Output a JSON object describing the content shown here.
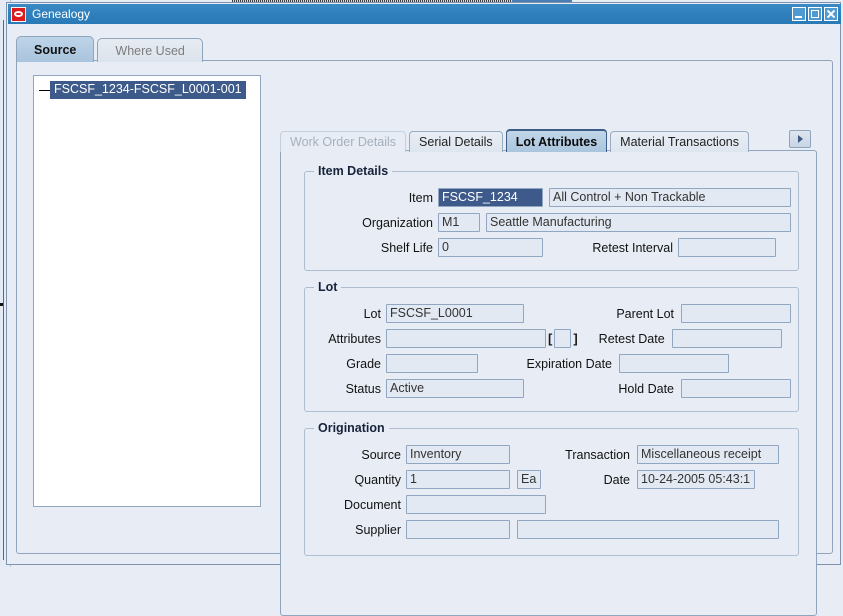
{
  "window": {
    "title": "Genealogy",
    "logo_icon": "oracle-logo-icon",
    "minimize_label": "minimize-icon",
    "maximize_label": "maximize-icon",
    "close_label": "close-icon"
  },
  "outer_tabs": [
    {
      "label": "Source",
      "active": true
    },
    {
      "label": "Where Used",
      "active": false
    }
  ],
  "tree": {
    "nodes": [
      {
        "label": "FSCSF_1234-FSCSF_L0001-001",
        "selected": true
      }
    ]
  },
  "inner_tabs": [
    {
      "label": "Work Order Details",
      "state": "disabled"
    },
    {
      "label": "Serial Details",
      "state": "enabled"
    },
    {
      "label": "Lot Attributes",
      "state": "active"
    },
    {
      "label": "Material Transactions",
      "state": "enabled"
    }
  ],
  "tab_scroll": {
    "icon": "tab-scroll-arrows-icon"
  },
  "item_details": {
    "legend": "Item Details",
    "item_label": "Item",
    "item_value": "FSCSF_1234",
    "item_description": "All Control + Non Trackable",
    "organization_label": "Organization",
    "organization_code": "M1",
    "organization_name": "Seattle Manufacturing",
    "shelf_life_label": "Shelf Life",
    "shelf_life_value": "0",
    "retest_interval_label": "Retest Interval",
    "retest_interval_value": ""
  },
  "lot": {
    "legend": "Lot",
    "lot_label": "Lot",
    "lot_value": "FSCSF_L0001",
    "attributes_label": "Attributes",
    "attributes_value": "",
    "bracket_open": "[",
    "bracket_close": "]",
    "grade_label": "Grade",
    "grade_value": "",
    "status_label": "Status",
    "status_value": "Active",
    "parent_lot_label": "Parent Lot",
    "parent_lot_value": "",
    "retest_date_label": "Retest Date",
    "retest_date_value": "",
    "expiration_date_label": "Expiration Date",
    "expiration_date_value": "",
    "hold_date_label": "Hold Date",
    "hold_date_value": ""
  },
  "origination": {
    "legend": "Origination",
    "source_label": "Source",
    "source_value": "Inventory",
    "quantity_label": "Quantity",
    "quantity_value": "1",
    "uom_value": "Ea",
    "document_label": "Document",
    "document_value": "",
    "supplier_label": "Supplier",
    "supplier_value": "",
    "supplier_name_value": "",
    "transaction_label": "Transaction",
    "transaction_value": "Miscellaneous receipt",
    "date_label": "Date",
    "date_value": "10-24-2005 05:43:1"
  },
  "colors": {
    "title_bar": "#2e80bd",
    "selection": "#3d5a8a",
    "panel_bg": "#e8edf5",
    "field_bg": "#e3e9f2",
    "border": "#8fa4bd",
    "active_tab": "#b4cbe2"
  }
}
